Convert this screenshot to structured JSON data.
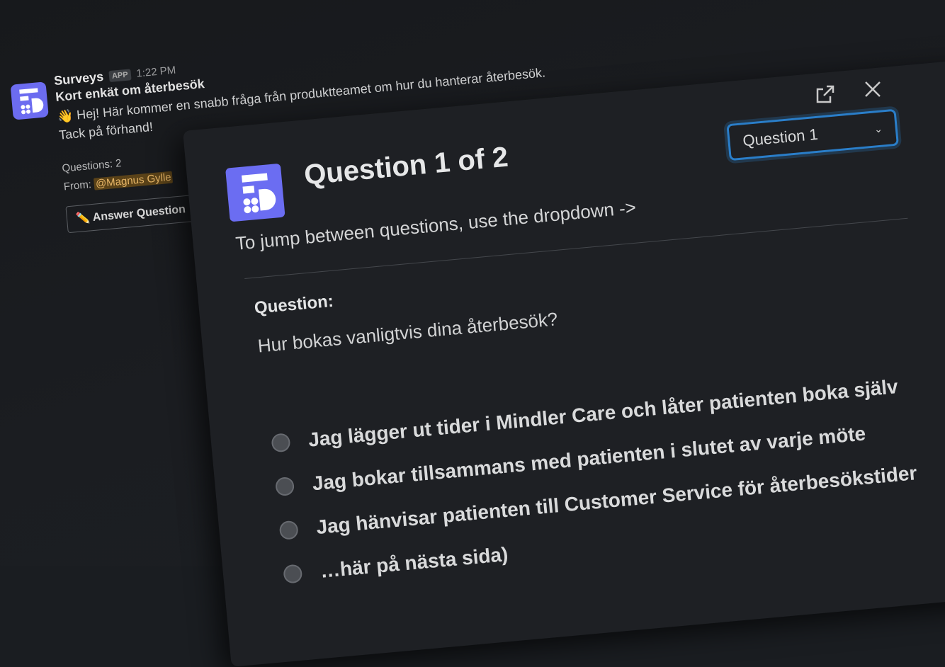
{
  "message": {
    "sender": "Surveys",
    "badge": "APP",
    "time": "1:22 PM",
    "title": "Kort enkät om återbesök",
    "text_line1": "👋 Hej! Här kommer en snabb fråga från produktteamet om hur du hanterar återbesök.",
    "text_line2": "Tack på förhand!",
    "questions": "Questions: 2",
    "from_label": "From:",
    "from_mention": "@Magnus Gylle",
    "answer_button": "✏️ Answer Question"
  },
  "modal": {
    "title": "Question 1 of 2",
    "dropdown_value": "Question 1",
    "instructions": "To jump between questions, use the dropdown ->",
    "question_label": "Question:",
    "question_text": "Hur bokas vanligtvis dina återbesök?",
    "options": [
      "Jag lägger ut tider i Mindler Care och låter patienten boka själv",
      "Jag bokar tillsammans med patienten i slutet av varje möte",
      "Jag hänvisar patienten till Customer Service för återbesökstider",
      "…här på nästa sida)"
    ]
  },
  "colors": {
    "accent": "#2a7ec9",
    "logo": "#6b6df2",
    "background": "#1a1d21"
  }
}
